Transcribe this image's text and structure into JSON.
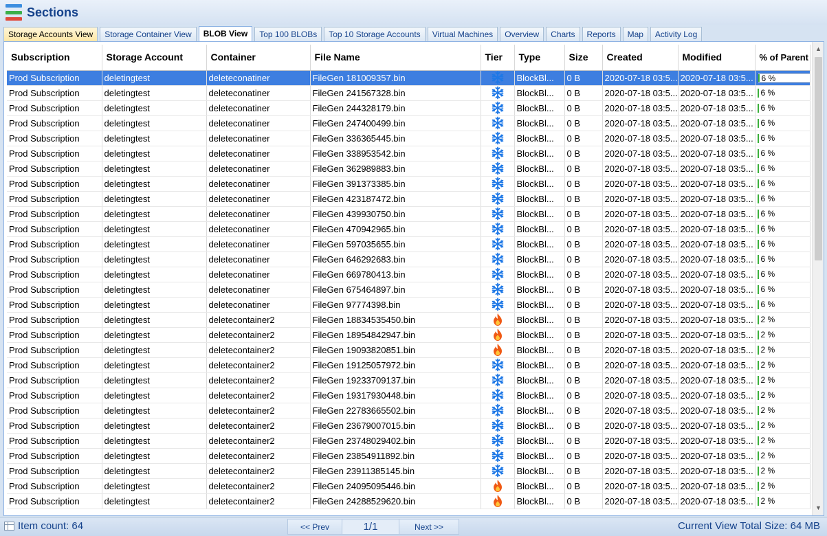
{
  "header": {
    "title": "Sections",
    "icon_colors": [
      "#3c8ee0",
      "#3cb04a",
      "#e04a3c"
    ]
  },
  "tabs": [
    {
      "label": "Storage Accounts View",
      "state": "highlighted"
    },
    {
      "label": "Storage Container View",
      "state": "normal"
    },
    {
      "label": "BLOB View",
      "state": "active"
    },
    {
      "label": "Top 100 BLOBs",
      "state": "normal"
    },
    {
      "label": "Top 10 Storage Accounts",
      "state": "normal"
    },
    {
      "label": "Virtual Machines",
      "state": "normal"
    },
    {
      "label": "Overview",
      "state": "normal"
    },
    {
      "label": "Charts",
      "state": "normal"
    },
    {
      "label": "Reports",
      "state": "normal"
    },
    {
      "label": "Map",
      "state": "normal"
    },
    {
      "label": "Activity Log",
      "state": "normal"
    }
  ],
  "grid": {
    "columns": [
      "Subscription",
      "Storage Account",
      "Container",
      "File Name",
      "Tier",
      "Type",
      "Size",
      "Created",
      "Modified",
      "% of Parent"
    ],
    "tier_icons": {
      "cool": "snowflake-icon",
      "hot": "flame-icon"
    },
    "rows": [
      {
        "subscription": "Prod Subscription",
        "account": "deletingtest",
        "container": "deleteconatiner",
        "file": "FileGen 181009357.bin",
        "tier": "cool",
        "type": "BlockBl...",
        "size": "0 B",
        "created": "2020-07-18 03:5...",
        "modified": "2020-07-18 03:5...",
        "pct": "6 %",
        "selected": true
      },
      {
        "subscription": "Prod Subscription",
        "account": "deletingtest",
        "container": "deleteconatiner",
        "file": "FileGen 241567328.bin",
        "tier": "cool",
        "type": "BlockBl...",
        "size": "0 B",
        "created": "2020-07-18 03:5...",
        "modified": "2020-07-18 03:5...",
        "pct": "6 %"
      },
      {
        "subscription": "Prod Subscription",
        "account": "deletingtest",
        "container": "deleteconatiner",
        "file": "FileGen 244328179.bin",
        "tier": "cool",
        "type": "BlockBl...",
        "size": "0 B",
        "created": "2020-07-18 03:5...",
        "modified": "2020-07-18 03:5...",
        "pct": "6 %"
      },
      {
        "subscription": "Prod Subscription",
        "account": "deletingtest",
        "container": "deleteconatiner",
        "file": "FileGen 247400499.bin",
        "tier": "cool",
        "type": "BlockBl...",
        "size": "0 B",
        "created": "2020-07-18 03:5...",
        "modified": "2020-07-18 03:5...",
        "pct": "6 %"
      },
      {
        "subscription": "Prod Subscription",
        "account": "deletingtest",
        "container": "deleteconatiner",
        "file": "FileGen 336365445.bin",
        "tier": "cool",
        "type": "BlockBl...",
        "size": "0 B",
        "created": "2020-07-18 03:5...",
        "modified": "2020-07-18 03:5...",
        "pct": "6 %"
      },
      {
        "subscription": "Prod Subscription",
        "account": "deletingtest",
        "container": "deleteconatiner",
        "file": "FileGen 338953542.bin",
        "tier": "cool",
        "type": "BlockBl...",
        "size": "0 B",
        "created": "2020-07-18 03:5...",
        "modified": "2020-07-18 03:5...",
        "pct": "6 %"
      },
      {
        "subscription": "Prod Subscription",
        "account": "deletingtest",
        "container": "deleteconatiner",
        "file": "FileGen 362989883.bin",
        "tier": "cool",
        "type": "BlockBl...",
        "size": "0 B",
        "created": "2020-07-18 03:5...",
        "modified": "2020-07-18 03:5...",
        "pct": "6 %"
      },
      {
        "subscription": "Prod Subscription",
        "account": "deletingtest",
        "container": "deleteconatiner",
        "file": "FileGen 391373385.bin",
        "tier": "cool",
        "type": "BlockBl...",
        "size": "0 B",
        "created": "2020-07-18 03:5...",
        "modified": "2020-07-18 03:5...",
        "pct": "6 %"
      },
      {
        "subscription": "Prod Subscription",
        "account": "deletingtest",
        "container": "deleteconatiner",
        "file": "FileGen 423187472.bin",
        "tier": "cool",
        "type": "BlockBl...",
        "size": "0 B",
        "created": "2020-07-18 03:5...",
        "modified": "2020-07-18 03:5...",
        "pct": "6 %"
      },
      {
        "subscription": "Prod Subscription",
        "account": "deletingtest",
        "container": "deleteconatiner",
        "file": "FileGen 439930750.bin",
        "tier": "cool",
        "type": "BlockBl...",
        "size": "0 B",
        "created": "2020-07-18 03:5...",
        "modified": "2020-07-18 03:5...",
        "pct": "6 %"
      },
      {
        "subscription": "Prod Subscription",
        "account": "deletingtest",
        "container": "deleteconatiner",
        "file": "FileGen 470942965.bin",
        "tier": "cool",
        "type": "BlockBl...",
        "size": "0 B",
        "created": "2020-07-18 03:5...",
        "modified": "2020-07-18 03:5...",
        "pct": "6 %"
      },
      {
        "subscription": "Prod Subscription",
        "account": "deletingtest",
        "container": "deleteconatiner",
        "file": "FileGen 597035655.bin",
        "tier": "cool",
        "type": "BlockBl...",
        "size": "0 B",
        "created": "2020-07-18 03:5...",
        "modified": "2020-07-18 03:5...",
        "pct": "6 %"
      },
      {
        "subscription": "Prod Subscription",
        "account": "deletingtest",
        "container": "deleteconatiner",
        "file": "FileGen 646292683.bin",
        "tier": "cool",
        "type": "BlockBl...",
        "size": "0 B",
        "created": "2020-07-18 03:5...",
        "modified": "2020-07-18 03:5...",
        "pct": "6 %"
      },
      {
        "subscription": "Prod Subscription",
        "account": "deletingtest",
        "container": "deleteconatiner",
        "file": "FileGen 669780413.bin",
        "tier": "cool",
        "type": "BlockBl...",
        "size": "0 B",
        "created": "2020-07-18 03:5...",
        "modified": "2020-07-18 03:5...",
        "pct": "6 %"
      },
      {
        "subscription": "Prod Subscription",
        "account": "deletingtest",
        "container": "deleteconatiner",
        "file": "FileGen 675464897.bin",
        "tier": "cool",
        "type": "BlockBl...",
        "size": "0 B",
        "created": "2020-07-18 03:5...",
        "modified": "2020-07-18 03:5...",
        "pct": "6 %"
      },
      {
        "subscription": "Prod Subscription",
        "account": "deletingtest",
        "container": "deleteconatiner",
        "file": "FileGen 97774398.bin",
        "tier": "cool",
        "type": "BlockBl...",
        "size": "0 B",
        "created": "2020-07-18 03:5...",
        "modified": "2020-07-18 03:5...",
        "pct": "6 %"
      },
      {
        "subscription": "Prod Subscription",
        "account": "deletingtest",
        "container": "deletecontainer2",
        "file": "FileGen 18834535450.bin",
        "tier": "hot",
        "type": "BlockBl...",
        "size": "0 B",
        "created": "2020-07-18 03:5...",
        "modified": "2020-07-18 03:5...",
        "pct": "2 %"
      },
      {
        "subscription": "Prod Subscription",
        "account": "deletingtest",
        "container": "deletecontainer2",
        "file": "FileGen 18954842947.bin",
        "tier": "hot",
        "type": "BlockBl...",
        "size": "0 B",
        "created": "2020-07-18 03:5...",
        "modified": "2020-07-18 03:5...",
        "pct": "2 %"
      },
      {
        "subscription": "Prod Subscription",
        "account": "deletingtest",
        "container": "deletecontainer2",
        "file": "FileGen 19093820851.bin",
        "tier": "hot",
        "type": "BlockBl...",
        "size": "0 B",
        "created": "2020-07-18 03:5...",
        "modified": "2020-07-18 03:5...",
        "pct": "2 %"
      },
      {
        "subscription": "Prod Subscription",
        "account": "deletingtest",
        "container": "deletecontainer2",
        "file": "FileGen 19125057972.bin",
        "tier": "cool",
        "type": "BlockBl...",
        "size": "0 B",
        "created": "2020-07-18 03:5...",
        "modified": "2020-07-18 03:5...",
        "pct": "2 %"
      },
      {
        "subscription": "Prod Subscription",
        "account": "deletingtest",
        "container": "deletecontainer2",
        "file": "FileGen 19233709137.bin",
        "tier": "cool",
        "type": "BlockBl...",
        "size": "0 B",
        "created": "2020-07-18 03:5...",
        "modified": "2020-07-18 03:5...",
        "pct": "2 %"
      },
      {
        "subscription": "Prod Subscription",
        "account": "deletingtest",
        "container": "deletecontainer2",
        "file": "FileGen 19317930448.bin",
        "tier": "cool",
        "type": "BlockBl...",
        "size": "0 B",
        "created": "2020-07-18 03:5...",
        "modified": "2020-07-18 03:5...",
        "pct": "2 %"
      },
      {
        "subscription": "Prod Subscription",
        "account": "deletingtest",
        "container": "deletecontainer2",
        "file": "FileGen 22783665502.bin",
        "tier": "cool",
        "type": "BlockBl...",
        "size": "0 B",
        "created": "2020-07-18 03:5...",
        "modified": "2020-07-18 03:5...",
        "pct": "2 %"
      },
      {
        "subscription": "Prod Subscription",
        "account": "deletingtest",
        "container": "deletecontainer2",
        "file": "FileGen 23679007015.bin",
        "tier": "cool",
        "type": "BlockBl...",
        "size": "0 B",
        "created": "2020-07-18 03:5...",
        "modified": "2020-07-18 03:5...",
        "pct": "2 %"
      },
      {
        "subscription": "Prod Subscription",
        "account": "deletingtest",
        "container": "deletecontainer2",
        "file": "FileGen 23748029402.bin",
        "tier": "cool",
        "type": "BlockBl...",
        "size": "0 B",
        "created": "2020-07-18 03:5...",
        "modified": "2020-07-18 03:5...",
        "pct": "2 %"
      },
      {
        "subscription": "Prod Subscription",
        "account": "deletingtest",
        "container": "deletecontainer2",
        "file": "FileGen 23854911892.bin",
        "tier": "cool",
        "type": "BlockBl...",
        "size": "0 B",
        "created": "2020-07-18 03:5...",
        "modified": "2020-07-18 03:5...",
        "pct": "2 %"
      },
      {
        "subscription": "Prod Subscription",
        "account": "deletingtest",
        "container": "deletecontainer2",
        "file": "FileGen 23911385145.bin",
        "tier": "cool",
        "type": "BlockBl...",
        "size": "0 B",
        "created": "2020-07-18 03:5...",
        "modified": "2020-07-18 03:5...",
        "pct": "2 %"
      },
      {
        "subscription": "Prod Subscription",
        "account": "deletingtest",
        "container": "deletecontainer2",
        "file": "FileGen 24095095446.bin",
        "tier": "hot",
        "type": "BlockBl...",
        "size": "0 B",
        "created": "2020-07-18 03:5...",
        "modified": "2020-07-18 03:5...",
        "pct": "2 %"
      },
      {
        "subscription": "Prod Subscription",
        "account": "deletingtest",
        "container": "deletecontainer2",
        "file": "FileGen 24288529620.bin",
        "tier": "hot",
        "type": "BlockBl...",
        "size": "0 B",
        "created": "2020-07-18 03:5...",
        "modified": "2020-07-18 03:5...",
        "pct": "2 %"
      }
    ]
  },
  "statusbar": {
    "item_count": "Item count: 64",
    "prev_label": "<< Prev",
    "page": "1/1",
    "next_label": "Next >>",
    "total_size": "Current View Total Size: 64 MB"
  },
  "colors": {
    "accent": "#15428b",
    "selection": "#3d7ee0",
    "snowflake": "#1e78e6",
    "flame": "#f05a14",
    "percent_bar": "#3ab03a"
  }
}
